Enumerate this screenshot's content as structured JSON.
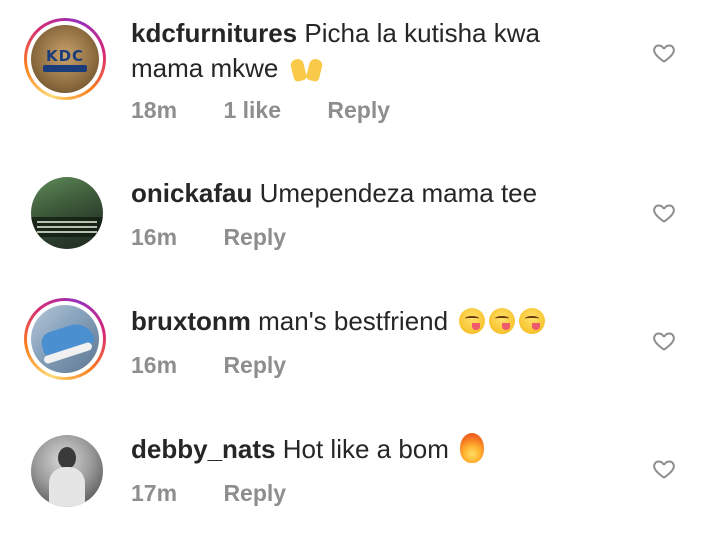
{
  "comments": [
    {
      "username": "kdcfurnitures",
      "text": "Picha la kutisha kwa mama mkwe",
      "emoji": "raising-hands",
      "time": "18m",
      "likes": "1 like",
      "reply": "Reply",
      "avatar_text": "KDC"
    },
    {
      "username": "onickafau",
      "text": "Umependeza mama tee",
      "time": "16m",
      "reply": "Reply"
    },
    {
      "username": "bruxtonm",
      "text": "man's bestfriend",
      "emoji": "yum-face x3",
      "time": "16m",
      "reply": "Reply"
    },
    {
      "username": "debby_nats",
      "text": "Hot like a bom",
      "emoji": "fire",
      "time": "17m",
      "reply": "Reply"
    }
  ],
  "colors": {
    "text": "#262626",
    "meta": "#8e8e8e",
    "heart": "#8e8e8e"
  }
}
